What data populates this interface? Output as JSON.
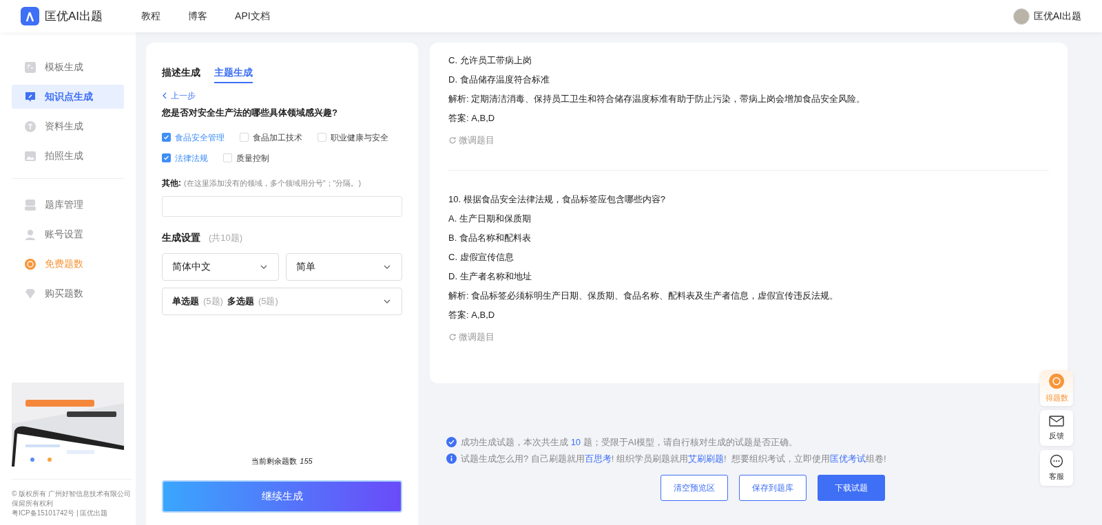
{
  "header": {
    "brand": "匡优AI出题",
    "nav": [
      {
        "label": "教程"
      },
      {
        "label": "博客"
      },
      {
        "label": "API文档"
      }
    ],
    "user": "匡优AI出题"
  },
  "sidebar": {
    "groups": [
      [
        {
          "label": "模板生成",
          "selected": false,
          "kind": "nav"
        },
        {
          "label": "知识点生成",
          "selected": true,
          "kind": "nav"
        },
        {
          "label": "资料生成",
          "selected": false,
          "kind": "nav"
        },
        {
          "label": "拍照生成",
          "selected": false,
          "kind": "nav"
        }
      ],
      [
        {
          "label": "题库管理",
          "selected": false,
          "kind": "nav"
        },
        {
          "label": "账号设置",
          "selected": false,
          "kind": "nav"
        },
        {
          "label": "免费题数",
          "selected": false,
          "kind": "promo"
        },
        {
          "label": "购买题数",
          "selected": false,
          "kind": "nav"
        }
      ]
    ],
    "footer": [
      "© 版权所有 广州好智信息技术有限公司",
      "保留所有权利",
      "粤ICP备15101742号 | 匡优出题"
    ]
  },
  "form": {
    "tabs": [
      {
        "label": "描述生成",
        "selected": false
      },
      {
        "label": "主题生成",
        "selected": true
      }
    ],
    "back": "上一步",
    "question": "您是否对安全生产法的哪些具体领域感兴趣?",
    "options": [
      [
        {
          "label": "食品安全管理",
          "checked": true
        },
        {
          "label": "食品加工技术",
          "checked": false
        },
        {
          "label": "职业健康与安全",
          "checked": false
        }
      ],
      [
        {
          "label": "法律法规",
          "checked": true
        },
        {
          "label": "质量控制",
          "checked": false
        }
      ]
    ],
    "other_label": "其他:",
    "other_hint": "(在这里添加没有的领域，多个领域用分号\"；\"分隔。)",
    "settings_title": "生成设置",
    "settings_count": "(共10题)",
    "language": "简体中文",
    "difficulty": "简单",
    "types": [
      {
        "name": "单选题",
        "count": "(5题)"
      },
      {
        "name": "多选题",
        "count": "(5题)"
      }
    ],
    "remaining_label": "当前剩余题数",
    "remaining": "155",
    "submit": "继续生成"
  },
  "preview": {
    "blocks": [
      {
        "lines": [
          "C. 允许员工带病上岗",
          "D. 食品储存温度符合标准",
          "解析: 定期清洁消毒、保持员工卫生和符合储存温度标准有助于防止污染，带病上岗会增加食品安全风险。",
          "答案: A,B,D"
        ],
        "refine": "微调题目"
      },
      {
        "lines": [
          "10. 根据食品安全法律法规，食品标签应包含哪些内容?",
          "A. 生产日期和保质期",
          "B. 食品名称和配料表",
          "C. 虚假宣传信息",
          "D. 生产者名称和地址",
          "解析: 食品标签必须标明生产日期、保质期、食品名称、配料表及生产者信息，虚假宣传违反法规。",
          "答案: A,B,D"
        ],
        "refine": "微调题目"
      }
    ]
  },
  "notes": [
    {
      "kind": "success",
      "parts": [
        {
          "text": "成功生成试题，本次共生成 ",
          "link": false
        },
        {
          "text": "10",
          "link": true
        },
        {
          "text": " 题；受限于AI模型，请自行核对生成的试题是否正确。",
          "link": false
        }
      ]
    },
    {
      "kind": "info",
      "parts": [
        {
          "text": "试题生成怎么用? 自己刷题就用",
          "link": false
        },
        {
          "text": "百思考",
          "link": true
        },
        {
          "text": "! 组织学员刷题就用",
          "link": false
        },
        {
          "text": "艾刷刷题",
          "link": true
        },
        {
          "text": "!  想要组织考试，立即使用",
          "link": false
        },
        {
          "text": "匡优考试",
          "link": true
        },
        {
          "text": "组卷!",
          "link": false
        }
      ]
    }
  ],
  "actions": [
    {
      "label": "清空预览区",
      "primary": false
    },
    {
      "label": "保存到题库",
      "primary": false
    },
    {
      "label": "下载试题",
      "primary": true
    }
  ],
  "float": [
    {
      "label": "得题数",
      "kind": "promo"
    },
    {
      "label": "反馈",
      "kind": "plain"
    },
    {
      "label": "客服",
      "kind": "plain"
    }
  ]
}
